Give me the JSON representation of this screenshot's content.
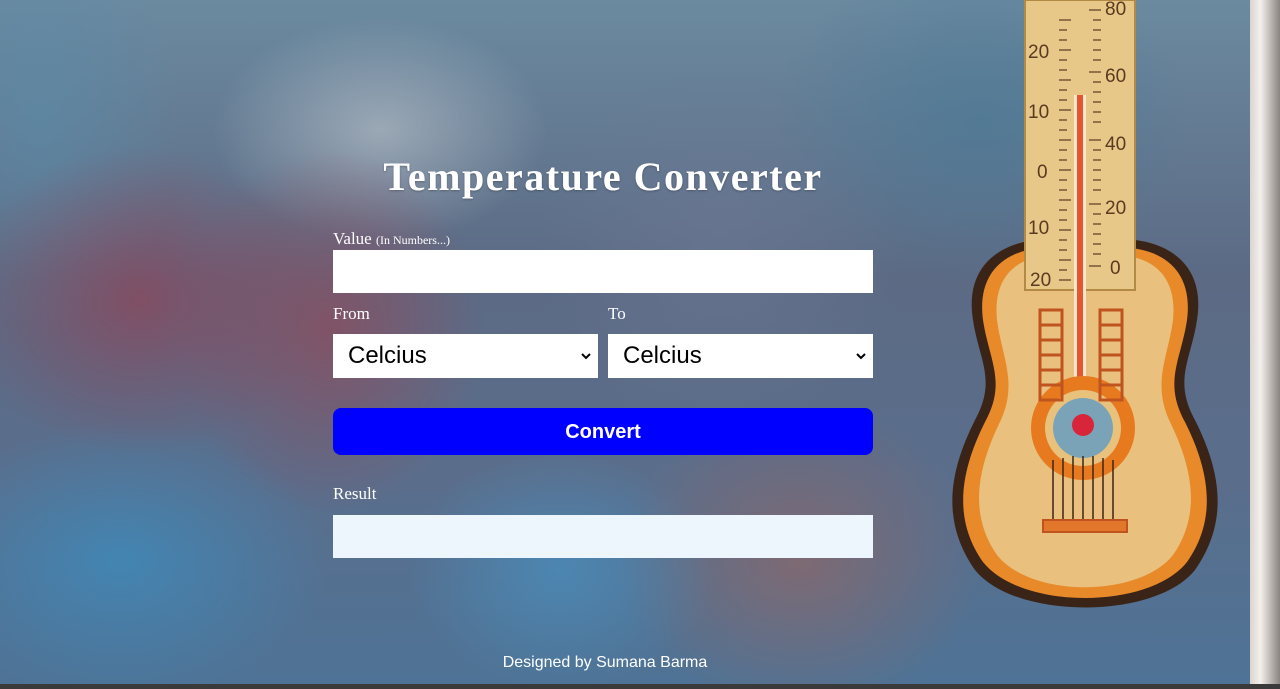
{
  "app": {
    "title": "Temperature Converter"
  },
  "form": {
    "value_label": "Value",
    "value_hint": "(In Numbers...)",
    "value_input": "",
    "from_label": "From",
    "from_selected": "Celcius",
    "to_label": "To",
    "to_selected": "Celcius",
    "convert_label": "Convert",
    "result_label": "Result",
    "result_value": ""
  },
  "thermometer": {
    "left_scale": [
      "20",
      "10",
      "0",
      "10",
      "20"
    ],
    "right_scale": [
      "80",
      "60",
      "40",
      "20",
      "0"
    ]
  },
  "footer": {
    "credit": "Designed by Sumana Barma"
  },
  "colors": {
    "convert_button": "#0000ff",
    "result_box": "#eef6fd"
  }
}
